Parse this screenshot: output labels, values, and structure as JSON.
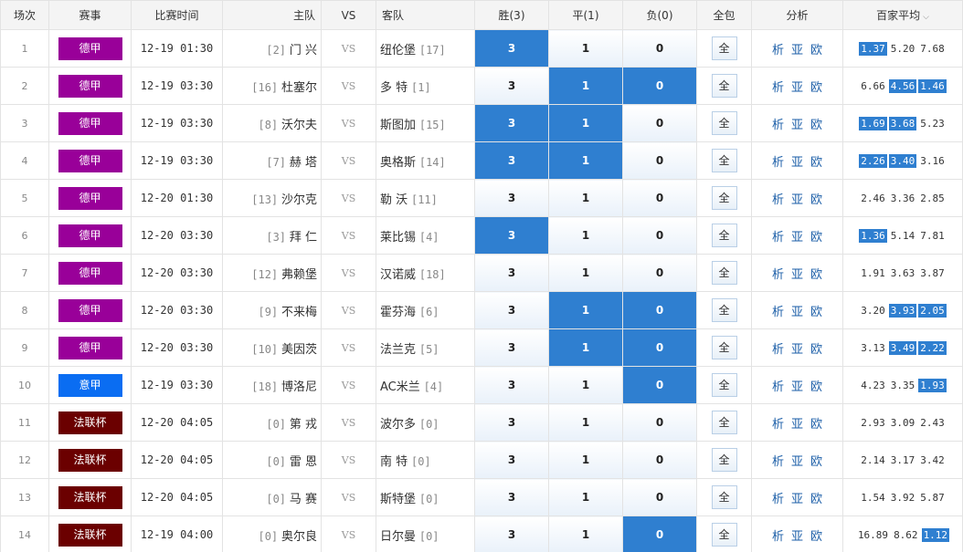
{
  "header": {
    "no": "场次",
    "league": "赛事",
    "time": "比赛时间",
    "home": "主队",
    "vs": "VS",
    "away": "客队",
    "win": "胜(3)",
    "draw": "平(1)",
    "lose": "负(0)",
    "all": "全包",
    "analysis": "分析",
    "avg": "百家平均",
    "avg_arrow": "⌵"
  },
  "colors": {
    "bundesliga": "#990099",
    "seriea": "#0a6df2",
    "coupe": "#6b0000",
    "accent": "#2f7fd0"
  },
  "rows": [
    {
      "no": "1",
      "league": "德甲",
      "league_color": "#990099",
      "time": "12-19 01:30",
      "home_rank": "[2]",
      "home": "门 兴",
      "vs": "VS",
      "away": "纽伦堡",
      "away_rank": "[17]",
      "w": "3",
      "d": "1",
      "l": "0",
      "sel": [
        1,
        0,
        0
      ],
      "all": "全",
      "an": [
        "析",
        "亚",
        "欧"
      ],
      "odds": [
        "1.37",
        "5.20",
        "7.68"
      ],
      "oh": [
        1,
        0,
        0
      ]
    },
    {
      "no": "2",
      "league": "德甲",
      "league_color": "#990099",
      "time": "12-19 03:30",
      "home_rank": "[16]",
      "home": "杜塞尔",
      "vs": "VS",
      "away": "多 特",
      "away_rank": "[1]",
      "w": "3",
      "d": "1",
      "l": "0",
      "sel": [
        0,
        1,
        1
      ],
      "all": "全",
      "an": [
        "析",
        "亚",
        "欧"
      ],
      "odds": [
        "6.66",
        "4.56",
        "1.46"
      ],
      "oh": [
        0,
        1,
        1
      ]
    },
    {
      "no": "3",
      "league": "德甲",
      "league_color": "#990099",
      "time": "12-19 03:30",
      "home_rank": "[8]",
      "home": "沃尔夫",
      "vs": "VS",
      "away": "斯图加",
      "away_rank": "[15]",
      "w": "3",
      "d": "1",
      "l": "0",
      "sel": [
        1,
        1,
        0
      ],
      "all": "全",
      "an": [
        "析",
        "亚",
        "欧"
      ],
      "odds": [
        "1.69",
        "3.68",
        "5.23"
      ],
      "oh": [
        1,
        1,
        0
      ]
    },
    {
      "no": "4",
      "league": "德甲",
      "league_color": "#990099",
      "time": "12-19 03:30",
      "home_rank": "[7]",
      "home": "赫 塔",
      "vs": "VS",
      "away": "奥格斯",
      "away_rank": "[14]",
      "w": "3",
      "d": "1",
      "l": "0",
      "sel": [
        1,
        1,
        0
      ],
      "all": "全",
      "an": [
        "析",
        "亚",
        "欧"
      ],
      "odds": [
        "2.26",
        "3.40",
        "3.16"
      ],
      "oh": [
        1,
        1,
        0
      ]
    },
    {
      "no": "5",
      "league": "德甲",
      "league_color": "#990099",
      "time": "12-20 01:30",
      "home_rank": "[13]",
      "home": "沙尔克",
      "vs": "VS",
      "away": "勒 沃",
      "away_rank": "[11]",
      "w": "3",
      "d": "1",
      "l": "0",
      "sel": [
        0,
        0,
        0
      ],
      "all": "全",
      "an": [
        "析",
        "亚",
        "欧"
      ],
      "odds": [
        "2.46",
        "3.36",
        "2.85"
      ],
      "oh": [
        0,
        0,
        0
      ]
    },
    {
      "no": "6",
      "league": "德甲",
      "league_color": "#990099",
      "time": "12-20 03:30",
      "home_rank": "[3]",
      "home": "拜 仁",
      "vs": "VS",
      "away": "莱比锡",
      "away_rank": "[4]",
      "w": "3",
      "d": "1",
      "l": "0",
      "sel": [
        1,
        0,
        0
      ],
      "all": "全",
      "an": [
        "析",
        "亚",
        "欧"
      ],
      "odds": [
        "1.36",
        "5.14",
        "7.81"
      ],
      "oh": [
        1,
        0,
        0
      ]
    },
    {
      "no": "7",
      "league": "德甲",
      "league_color": "#990099",
      "time": "12-20 03:30",
      "home_rank": "[12]",
      "home": "弗赖堡",
      "vs": "VS",
      "away": "汉诺威",
      "away_rank": "[18]",
      "w": "3",
      "d": "1",
      "l": "0",
      "sel": [
        0,
        0,
        0
      ],
      "all": "全",
      "an": [
        "析",
        "亚",
        "欧"
      ],
      "odds": [
        "1.91",
        "3.63",
        "3.87"
      ],
      "oh": [
        0,
        0,
        0
      ]
    },
    {
      "no": "8",
      "league": "德甲",
      "league_color": "#990099",
      "time": "12-20 03:30",
      "home_rank": "[9]",
      "home": "不来梅",
      "vs": "VS",
      "away": "霍芬海",
      "away_rank": "[6]",
      "w": "3",
      "d": "1",
      "l": "0",
      "sel": [
        0,
        1,
        1
      ],
      "all": "全",
      "an": [
        "析",
        "亚",
        "欧"
      ],
      "odds": [
        "3.20",
        "3.93",
        "2.05"
      ],
      "oh": [
        0,
        1,
        1
      ]
    },
    {
      "no": "9",
      "league": "德甲",
      "league_color": "#990099",
      "time": "12-20 03:30",
      "home_rank": "[10]",
      "home": "美因茨",
      "vs": "VS",
      "away": "法兰克",
      "away_rank": "[5]",
      "w": "3",
      "d": "1",
      "l": "0",
      "sel": [
        0,
        1,
        1
      ],
      "all": "全",
      "an": [
        "析",
        "亚",
        "欧"
      ],
      "odds": [
        "3.13",
        "3.49",
        "2.22"
      ],
      "oh": [
        0,
        1,
        1
      ]
    },
    {
      "no": "10",
      "league": "意甲",
      "league_color": "#0a6df2",
      "time": "12-19 03:30",
      "home_rank": "[18]",
      "home": "博洛尼",
      "vs": "VS",
      "away": "AC米兰",
      "away_rank": "[4]",
      "w": "3",
      "d": "1",
      "l": "0",
      "sel": [
        0,
        0,
        1
      ],
      "all": "全",
      "an": [
        "析",
        "亚",
        "欧"
      ],
      "odds": [
        "4.23",
        "3.35",
        "1.93"
      ],
      "oh": [
        0,
        0,
        1
      ]
    },
    {
      "no": "11",
      "league": "法联杯",
      "league_color": "#6b0000",
      "time": "12-20 04:05",
      "home_rank": "[0]",
      "home": "第 戎",
      "vs": "VS",
      "away": "波尔多",
      "away_rank": "[0]",
      "w": "3",
      "d": "1",
      "l": "0",
      "sel": [
        0,
        0,
        0
      ],
      "all": "全",
      "an": [
        "析",
        "亚",
        "欧"
      ],
      "odds": [
        "2.93",
        "3.09",
        "2.43"
      ],
      "oh": [
        0,
        0,
        0
      ]
    },
    {
      "no": "12",
      "league": "法联杯",
      "league_color": "#6b0000",
      "time": "12-20 04:05",
      "home_rank": "[0]",
      "home": "雷 恩",
      "vs": "VS",
      "away": "南 特",
      "away_rank": "[0]",
      "w": "3",
      "d": "1",
      "l": "0",
      "sel": [
        0,
        0,
        0
      ],
      "all": "全",
      "an": [
        "析",
        "亚",
        "欧"
      ],
      "odds": [
        "2.14",
        "3.17",
        "3.42"
      ],
      "oh": [
        0,
        0,
        0
      ]
    },
    {
      "no": "13",
      "league": "法联杯",
      "league_color": "#6b0000",
      "time": "12-20 04:05",
      "home_rank": "[0]",
      "home": "马 赛",
      "vs": "VS",
      "away": "斯特堡",
      "away_rank": "[0]",
      "w": "3",
      "d": "1",
      "l": "0",
      "sel": [
        0,
        0,
        0
      ],
      "all": "全",
      "an": [
        "析",
        "亚",
        "欧"
      ],
      "odds": [
        "1.54",
        "3.92",
        "5.87"
      ],
      "oh": [
        0,
        0,
        0
      ]
    },
    {
      "no": "14",
      "league": "法联杯",
      "league_color": "#6b0000",
      "time": "12-19 04:00",
      "home_rank": "[0]",
      "home": "奥尔良",
      "vs": "VS",
      "away": "日尔曼",
      "away_rank": "[0]",
      "w": "3",
      "d": "1",
      "l": "0",
      "sel": [
        0,
        0,
        1
      ],
      "all": "全",
      "an": [
        "析",
        "亚",
        "欧"
      ],
      "odds": [
        "16.89",
        "8.62",
        "1.12"
      ],
      "oh": [
        0,
        0,
        1
      ]
    }
  ]
}
